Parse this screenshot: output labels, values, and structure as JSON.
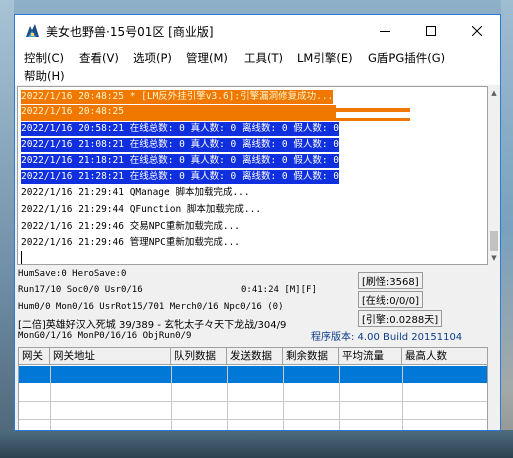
{
  "window": {
    "title": "美女也野兽·15号01区 [商业版]"
  },
  "menu": {
    "items": [
      "控制(C)",
      "查看(V)",
      "选项(P)",
      "管理(M)",
      "工具(T)",
      "LM引擎(E)",
      "G盾PG插件(G)",
      "帮助(H)"
    ]
  },
  "log": {
    "lines": [
      {
        "time": "2022/1/16 20:48:25",
        "text": "* [LM反外挂引擎v3.6]:引擎漏洞修复成功...",
        "style": "orange"
      },
      {
        "time": "2022/1/16 20:48:25",
        "text": "------------------------------------",
        "style": "orange"
      },
      {
        "time": "2022/1/16 20:58:21",
        "text": "在线总数: 0 真人数: 0 离线数: 0 假人数: 0",
        "style": "blue"
      },
      {
        "time": "2022/1/16 21:08:21",
        "text": "在线总数: 0 真人数: 0 离线数: 0 假人数: 0",
        "style": "blue"
      },
      {
        "time": "2022/1/16 21:18:21",
        "text": "在线总数: 0 真人数: 0 离线数: 0 假人数: 0",
        "style": "blue"
      },
      {
        "time": "2022/1/16 21:28:21",
        "text": "在线总数: 0 真人数: 0 离线数: 0 假人数: 0",
        "style": "blue"
      },
      {
        "time": "2022/1/16 21:29:41",
        "text": "QManage 脚本加载完成...",
        "style": "normal"
      },
      {
        "time": "2022/1/16 21:29:44",
        "text": "QFunction 脚本加载完成...",
        "style": "normal"
      },
      {
        "time": "2022/1/16 21:29:46",
        "text": "交易NPC重新加载完成...",
        "style": "normal"
      },
      {
        "time": "2022/1/16 21:29:46",
        "text": "管理NPC重新加载完成...",
        "style": "normal"
      }
    ]
  },
  "status": {
    "hum_save": "HumSave:0 HeroSave:0",
    "run": "Run17/10 Soc0/0 Usr0/16",
    "clock": "0:41:24 [M][F]",
    "hum": "Hum0/0 Mon0/16 UsrRot15/701 Merch0/16 Npc0/16 (0)",
    "guild": "[二倍]英雄好汉入死城 39/389 - 玄牝太子々天下龙战/304/9",
    "mon": "MonG0/1/16 MonP0/16/16 ObjRun0/9",
    "shuaguai": "[刷怪:3568]",
    "online": "[在线:0/0/0]",
    "engine": "[引擎:0.0288天]",
    "version": "程序版本: 4.00 Build 20151104"
  },
  "grid": {
    "columns": [
      "网关",
      "网关地址",
      "队列数据",
      "发送数据",
      "剩余数据",
      "平均流量",
      "最高人数"
    ],
    "rows": []
  },
  "colors": {
    "accent": "#0078d7",
    "log_orange": "#f07800",
    "log_blue": "#1030e0",
    "version_text": "#0b3d8c"
  }
}
